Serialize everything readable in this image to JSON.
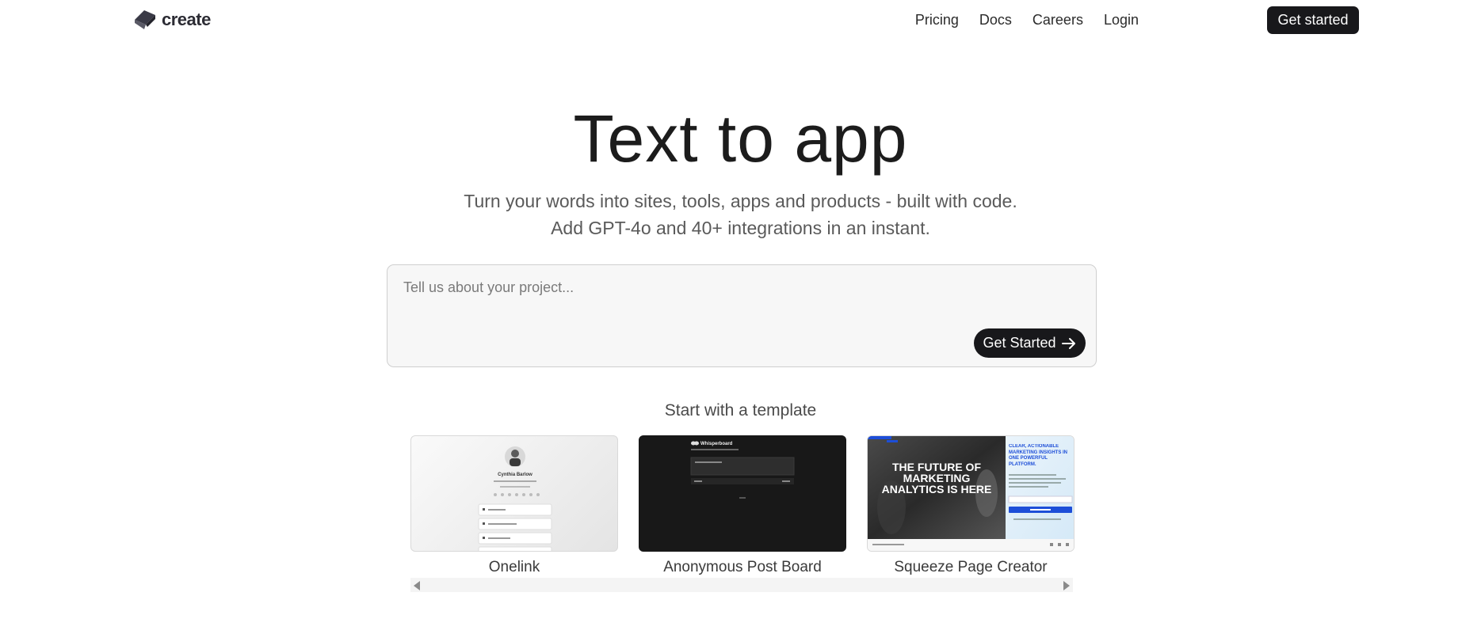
{
  "header": {
    "logo_text": "create",
    "links": [
      "Pricing",
      "Docs",
      "Careers",
      "Login"
    ],
    "cta": "Get started"
  },
  "hero": {
    "title": "Text to app",
    "subtitle_line1": "Turn your words into sites, tools, apps and products - built with code.",
    "subtitle_line2": "Add GPT-4o and 40+ integrations in an instant."
  },
  "prompt": {
    "placeholder": "Tell us about your project...",
    "button": "Get Started"
  },
  "templates": {
    "heading": "Start with a template",
    "items": [
      {
        "name": "Onelink",
        "preview": {
          "profile_name": "Cynthia Barlow"
        }
      },
      {
        "name": "Anonymous Post Board",
        "preview": {
          "brand": "Whisperboard"
        }
      },
      {
        "name": "Squeeze Page Creator",
        "preview": {
          "headline": "THE FUTURE OF MARKETING ANALYTICS IS HERE",
          "side_headline": "CLEAR, ACTIONABLE MARKETING INSIGHTS IN ONE POWERFUL PLATFORM."
        }
      }
    ]
  },
  "colors": {
    "primary_button": "#18181b",
    "prompt_background": "#f7f7f7",
    "squeeze_accent": "#1d4ed8"
  }
}
